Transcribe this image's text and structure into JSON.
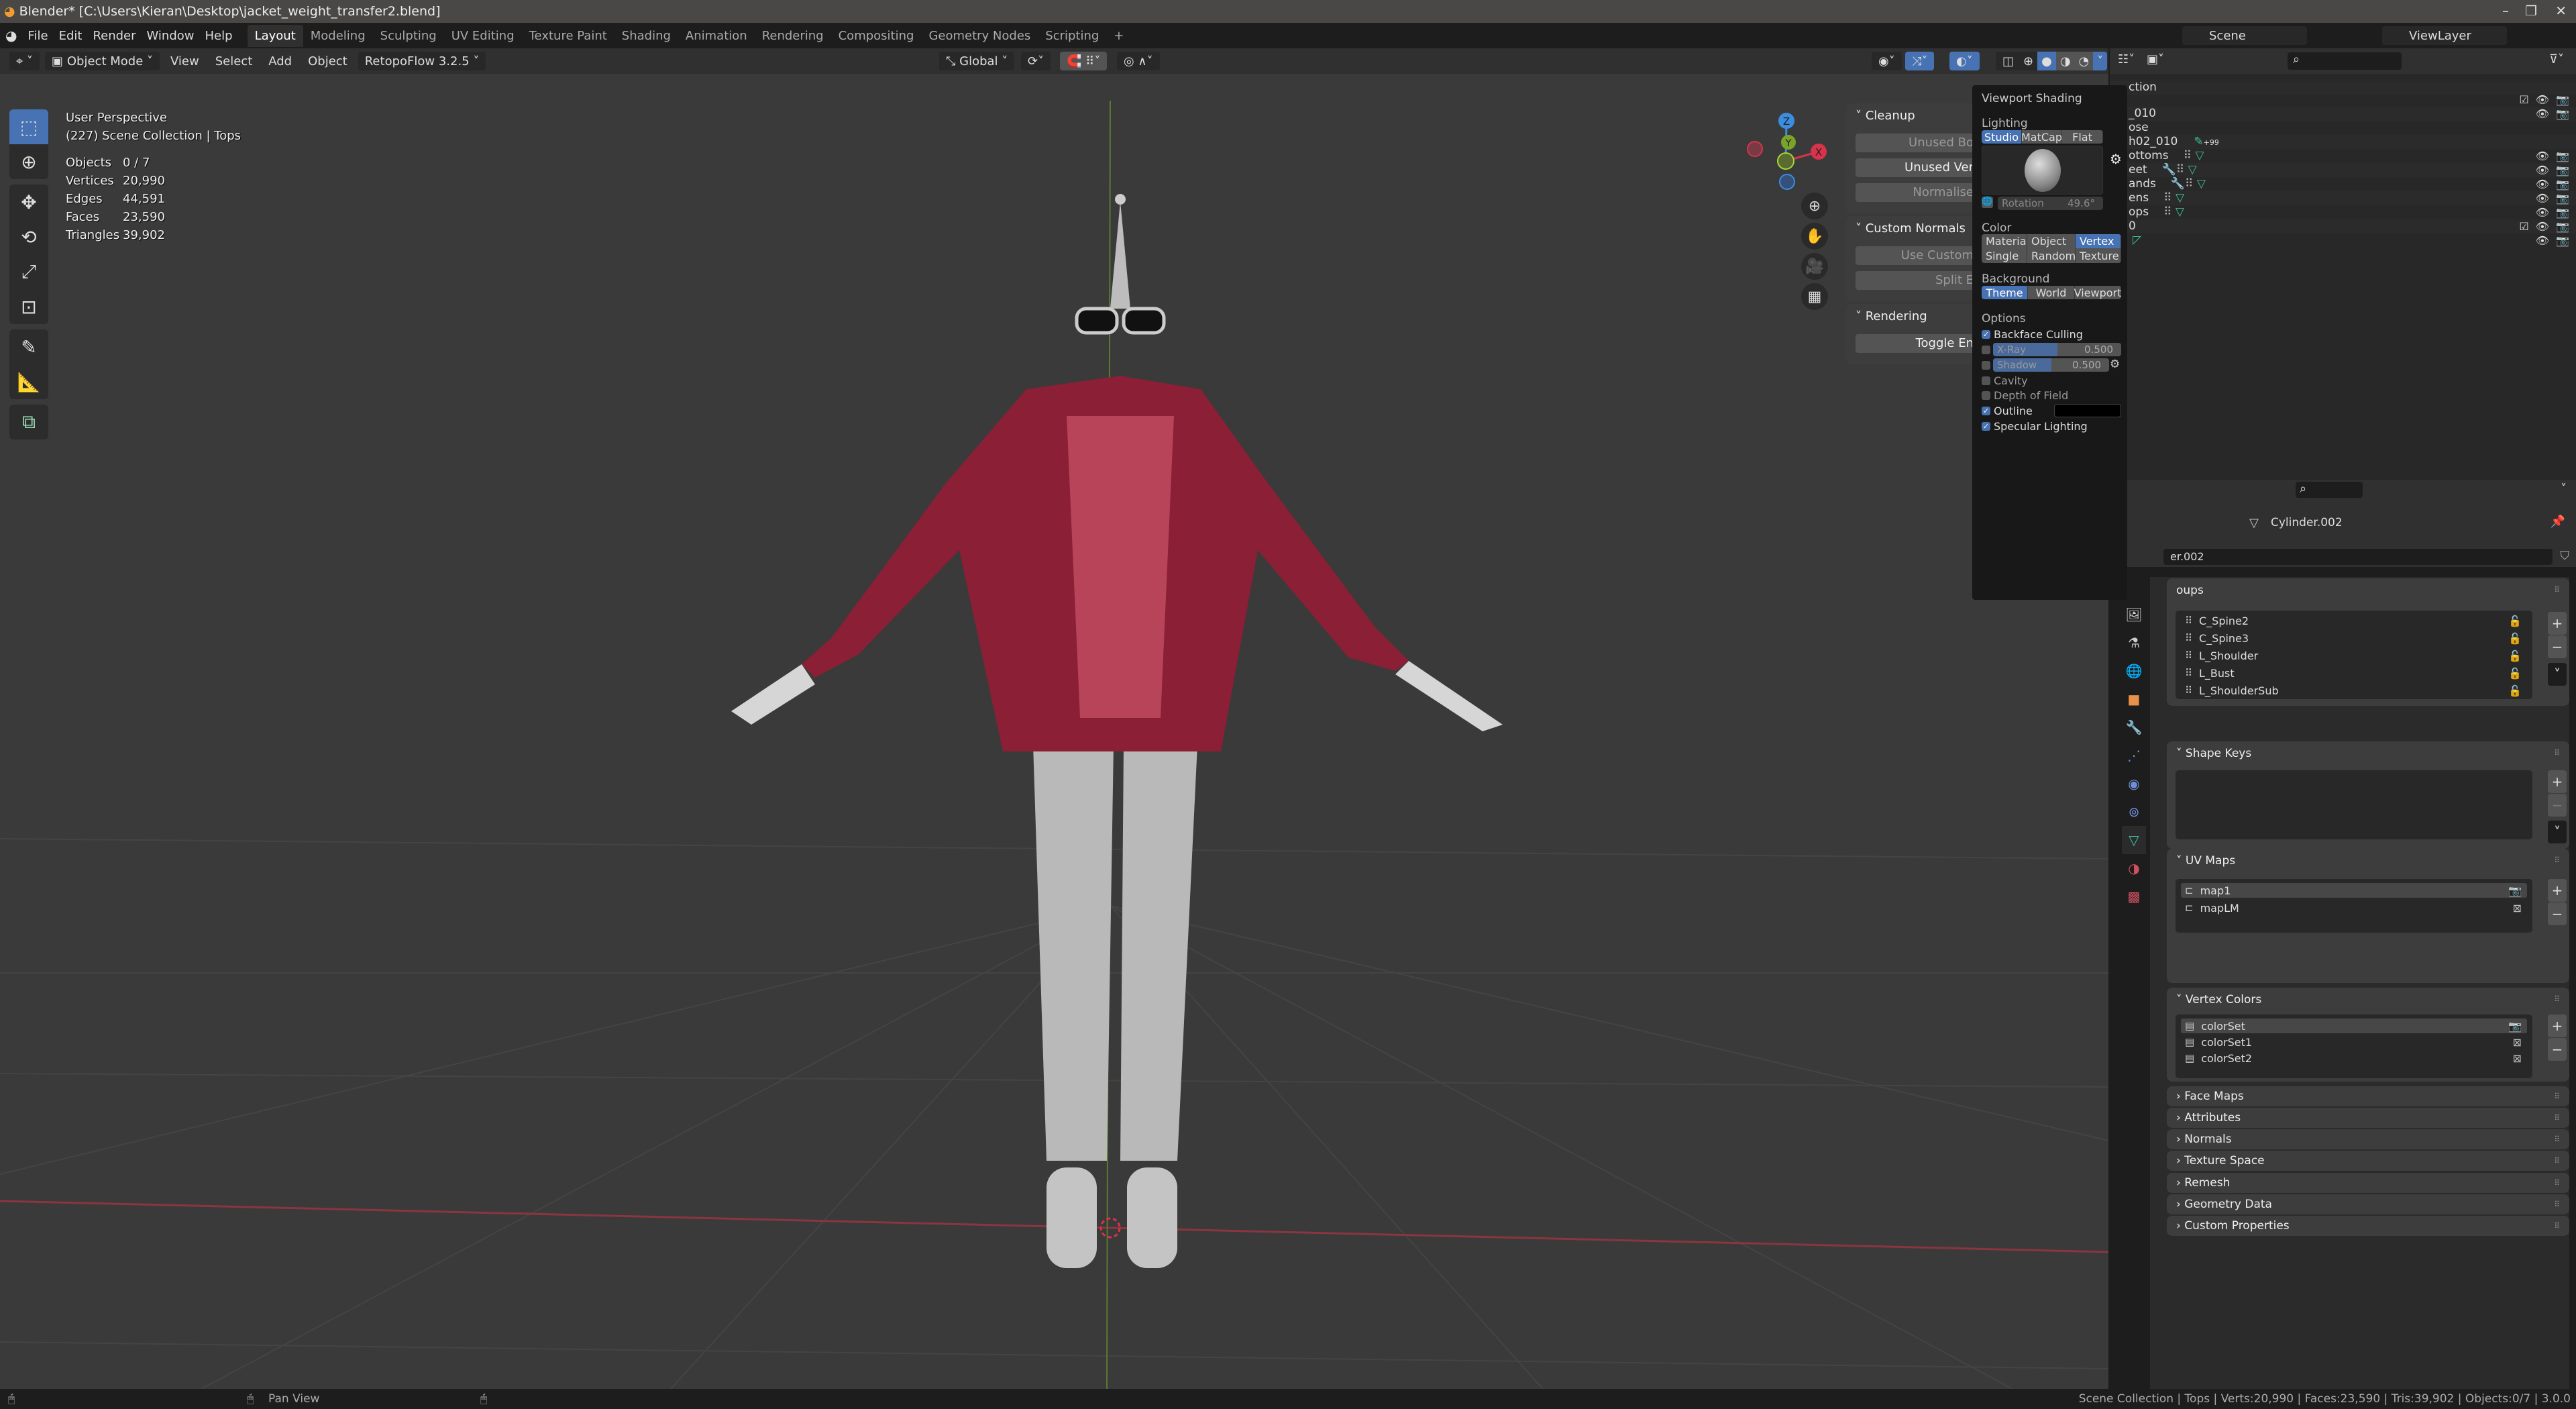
{
  "window": {
    "title": "Blender* [C:\\Users\\Kieran\\Desktop\\jacket_weight_transfer2.blend]",
    "minimize": "–",
    "maximize": "❐",
    "close": "✕"
  },
  "menu": {
    "items": [
      "File",
      "Edit",
      "Render",
      "Window",
      "Help"
    ],
    "workspaces": [
      "Layout",
      "Modeling",
      "Sculpting",
      "UV Editing",
      "Texture Paint",
      "Shading",
      "Animation",
      "Rendering",
      "Compositing",
      "Geometry Nodes",
      "Scripting",
      "+"
    ],
    "active_workspace": "Layout",
    "scene": "Scene",
    "view_layer": "ViewLayer"
  },
  "viewport_header": {
    "mode": "Object Mode",
    "menus": [
      "View",
      "Select",
      "Add",
      "Object"
    ],
    "addon": "RetopoFlow 3.2.5",
    "orientation": "Global"
  },
  "overlay": {
    "view_name": "User Perspective",
    "collection": "(227) Scene Collection | Tops",
    "stats": [
      {
        "label": "Objects",
        "value": "0 / 7"
      },
      {
        "label": "Vertices",
        "value": "20,990"
      },
      {
        "label": "Edges",
        "value": "44,591"
      },
      {
        "label": "Faces",
        "value": "23,590"
      },
      {
        "label": "Triangles",
        "value": "39,902"
      }
    ]
  },
  "gizmo": {
    "axes": [
      "Z",
      "Y",
      "X"
    ]
  },
  "sidebar": {
    "sections": [
      {
        "title": "Cleanup",
        "buttons": [
          "Unused Bo",
          "Unused Ver",
          "Normalise"
        ]
      },
      {
        "title": "Custom Normals",
        "buttons": [
          "Use Custom",
          "Split E"
        ]
      },
      {
        "title": "Rendering",
        "buttons": [
          "Toggle En"
        ]
      }
    ]
  },
  "shading_popover": {
    "title": "Viewport Shading",
    "lighting_label": "Lighting",
    "lighting": [
      "Studio",
      "MatCap",
      "Flat"
    ],
    "lighting_selected": "Studio",
    "rotation_label": "Rotation",
    "rotation_value": "49.6°",
    "color_label": "Color",
    "color": [
      "Material",
      "Object",
      "Vertex",
      "Single",
      "Random",
      "Texture"
    ],
    "color_selected": "Vertex",
    "background_label": "Background",
    "background": [
      "Theme",
      "World",
      "Viewport"
    ],
    "background_selected": "Theme",
    "options_label": "Options",
    "backface_culling": {
      "label": "Backface Culling",
      "checked": true
    },
    "xray": {
      "label": "X-Ray",
      "checked": false,
      "value": "0.500",
      "fraction": 0.5
    },
    "shadow": {
      "label": "Shadow",
      "checked": false,
      "value": "0.500",
      "fraction": 0.5
    },
    "cavity": {
      "label": "Cavity",
      "checked": false
    },
    "dof": {
      "label": "Depth of Field",
      "checked": false
    },
    "outline": {
      "label": "Outline",
      "checked": true,
      "color": "#000000"
    },
    "specular": {
      "label": "Specular Lighting",
      "checked": true
    }
  },
  "outliner": {
    "header_fragment": "ction",
    "rows": [
      "_010",
      "ose",
      "h02_010",
      "ottoms",
      "eet",
      "ands",
      "ens",
      "ops",
      "0",
      ""
    ],
    "badge": "+99"
  },
  "properties": {
    "object_name": "Cylinder.002",
    "data_name_fragment": "er.002",
    "vertex_groups_fragment": "oups",
    "vertex_groups": [
      "C_Spine2",
      "C_Spine3",
      "L_Shoulder",
      "L_Bust",
      "L_ShoulderSub"
    ],
    "shape_keys_title": "Shape Keys",
    "uv_maps_title": "UV Maps",
    "uv_maps": [
      "map1",
      "mapLM"
    ],
    "vertex_colors_title": "Vertex Colors",
    "vertex_colors": [
      "colorSet",
      "colorSet1",
      "colorSet2"
    ],
    "collapsed_panels": [
      "Face Maps",
      "Attributes",
      "Normals",
      "Texture Space",
      "Remesh",
      "Geometry Data",
      "Custom Properties"
    ]
  },
  "statusbar": {
    "hint": "Pan View",
    "info": "Scene Collection | Tops | Verts:20,990 | Faces:23,590 | Tris:39,902 | Objects:0/7 | 3.0.0"
  },
  "colors": {
    "accent": "#4772b3",
    "jacket": "#8a1f35",
    "mesh": "#bdbdbd",
    "x_axis": "#d8334a",
    "y_axis": "#7aa32a",
    "z_axis": "#3b8de0"
  }
}
